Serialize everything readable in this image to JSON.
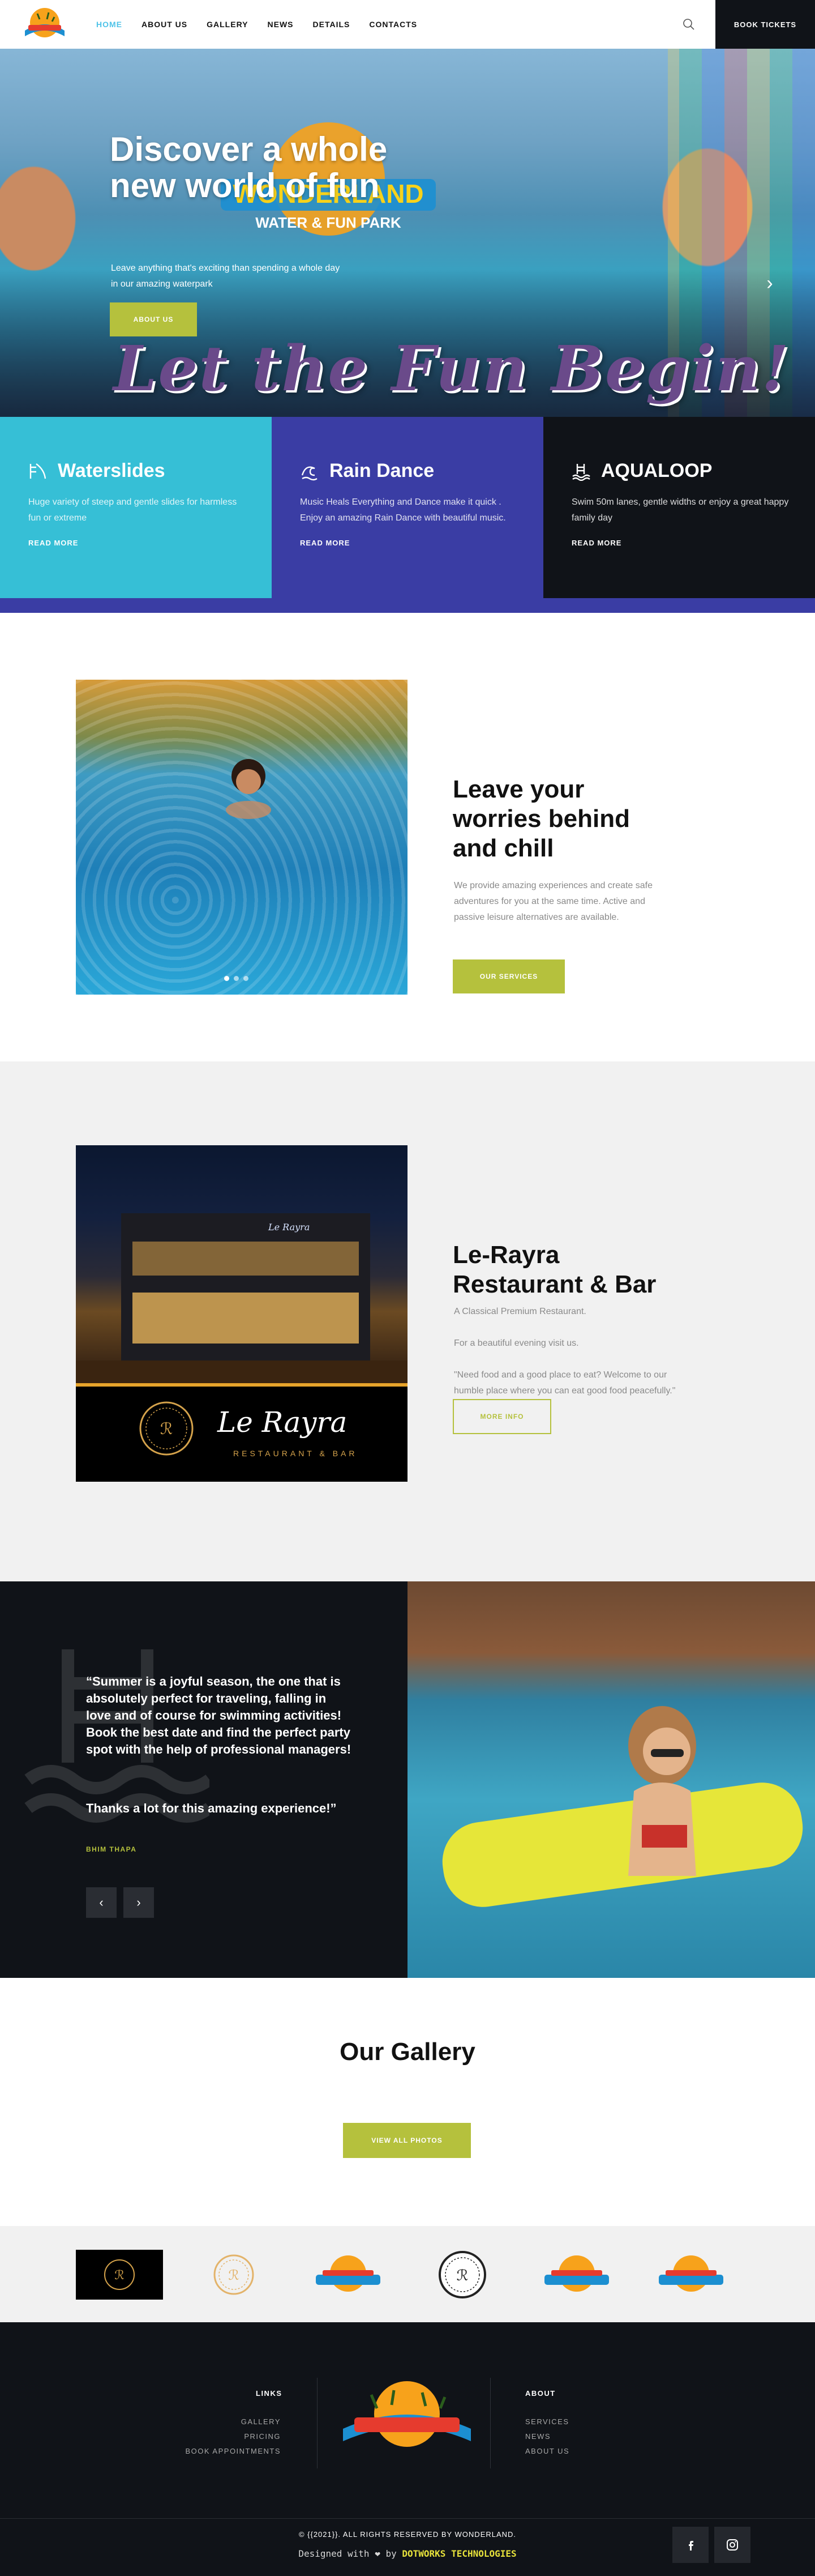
{
  "header": {
    "nav": [
      "HOME",
      "ABOUT US",
      "GALLERY",
      "NEWS",
      "DETAILS",
      "CONTACTS"
    ],
    "active_nav": "HOME",
    "tickets_label": "BOOK TICKETS",
    "logo_icon": "wonderland-logo",
    "search_icon": "search-icon"
  },
  "hero": {
    "title": "Discover a whole new world of fun",
    "subtitle": "Leave anything that's exciting than spending a whole day in our amazing waterpark",
    "button": "ABOUT US",
    "script_text": "Let the Fun Begin!",
    "logo_text": "WONDERLAND",
    "logo_sub": "WATER & FUN PARK"
  },
  "features": [
    {
      "title": "Waterslides",
      "desc": "Huge variety of steep and gentle slides for harmless fun or extreme",
      "link": "READ MORE",
      "icon": "waterslide-icon"
    },
    {
      "title": "Rain Dance",
      "desc": "Music Heals Everything and Dance make it quick . Enjoy an amazing Rain Dance with beautiful music.",
      "link": "READ MORE",
      "icon": "wave-icon"
    },
    {
      "title": "AQUALOOP",
      "desc": "Swim 50m lanes, gentle widths or enjoy a great happy family day",
      "link": "READ MORE",
      "icon": "pool-ladder-icon"
    }
  ],
  "about": {
    "title": "Leave your worries behind and chill",
    "text": "We provide amazing experiences and create safe adventures for you at the same time. Active and passive leisure alternatives are available.",
    "button": "OUR SERVICES"
  },
  "restaurant": {
    "title": "Le-Rayra Restaurant & Bar",
    "p1": "A Classical Premium Restaurant.",
    "p2": "For a beautiful evening visit us.",
    "p3": "\"Need food and a good place to eat? Welcome to our humble place where you can eat good food peacefully.\"",
    "button": "MORE INFO",
    "image_name": "Le Rayra",
    "image_sub": "RESTAURANT & BAR",
    "image_sign": "Le Rayra"
  },
  "testimonial": {
    "quote": "“Summer is a joyful season, the one that is absolutely perfect for traveling, falling in love and of course for swimming activities! Book the best date and find the perfect party spot with the help of professional managers!",
    "thanks": "Thanks a lot for this amazing experience!”",
    "author": "BHIM THAPA",
    "prev": "‹",
    "next": "›"
  },
  "gallery": {
    "title": "Our Gallery",
    "button": "VIEW ALL PHOTOS"
  },
  "partner_logos": [
    "le-rayra-black",
    "le-rayra-gold",
    "wonderland",
    "le-rayra-white",
    "wonderland",
    "wonderland"
  ],
  "footer": {
    "links_title": "LINKS",
    "links": [
      "GALLERY",
      "PRICING",
      "BOOK APPOINTMENTS"
    ],
    "about_title": "ABOUT",
    "about_links": [
      "SERVICES",
      "NEWS",
      "ABOUT US"
    ],
    "copyright": "© {{2021}}. ALL RIGHTS RESERVED BY WONDERLAND.",
    "designed_prefix": "Designed with",
    "heart": "❤",
    "designed_by": "by",
    "designer": "DOTWORKS TECHNOLOGIES",
    "social": [
      "facebook-icon",
      "instagram-icon"
    ]
  },
  "colors": {
    "accent": "#b5c13d",
    "nav_active": "#4fc3e8",
    "cyan": "#36bfd6",
    "indigo": "#3a3da4",
    "dark": "#101318"
  }
}
